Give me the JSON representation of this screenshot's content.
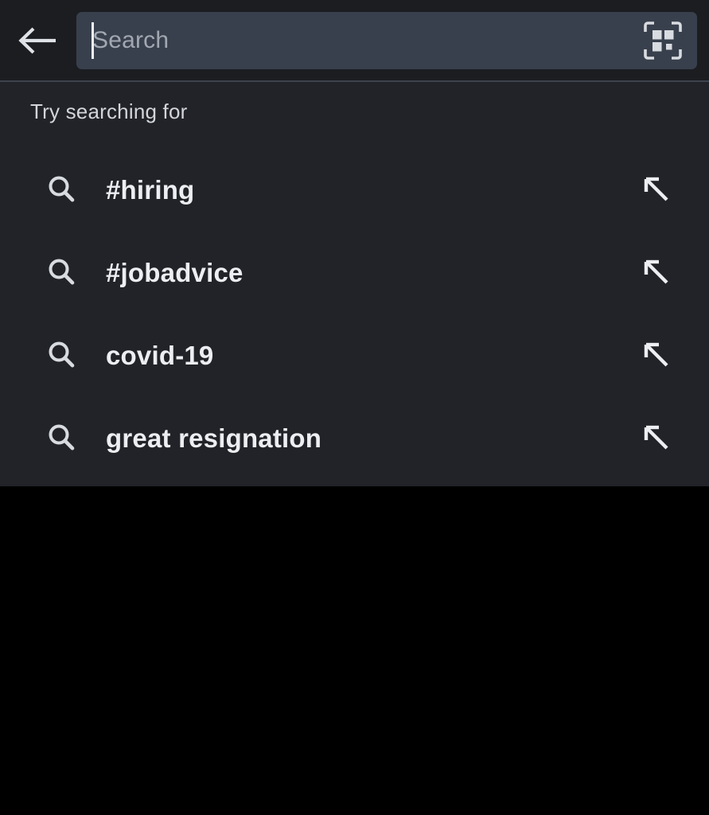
{
  "header": {
    "back_icon": "arrow-left-icon",
    "search": {
      "value": "",
      "placeholder": "Search",
      "caret_visible": true
    },
    "qr_icon": "qr-code-scan-icon"
  },
  "suggestions": {
    "section_title": "Try searching for",
    "row_icon": "search-icon",
    "fill_icon": "arrow-up-left-icon",
    "items": [
      {
        "label": "#hiring"
      },
      {
        "label": "#jobadvice"
      },
      {
        "label": "covid-19"
      },
      {
        "label": "great resignation"
      }
    ]
  },
  "colors": {
    "header_background": "#1b1d21",
    "search_field_background": "#39404d",
    "panel_background": "#212328",
    "empty_background": "#000000",
    "divider": "#3d434d",
    "primary_text": "#eceef1",
    "secondary_text": "#d2d5da",
    "placeholder_text": "#a2a8b2",
    "icon": "#d8dbe0"
  }
}
